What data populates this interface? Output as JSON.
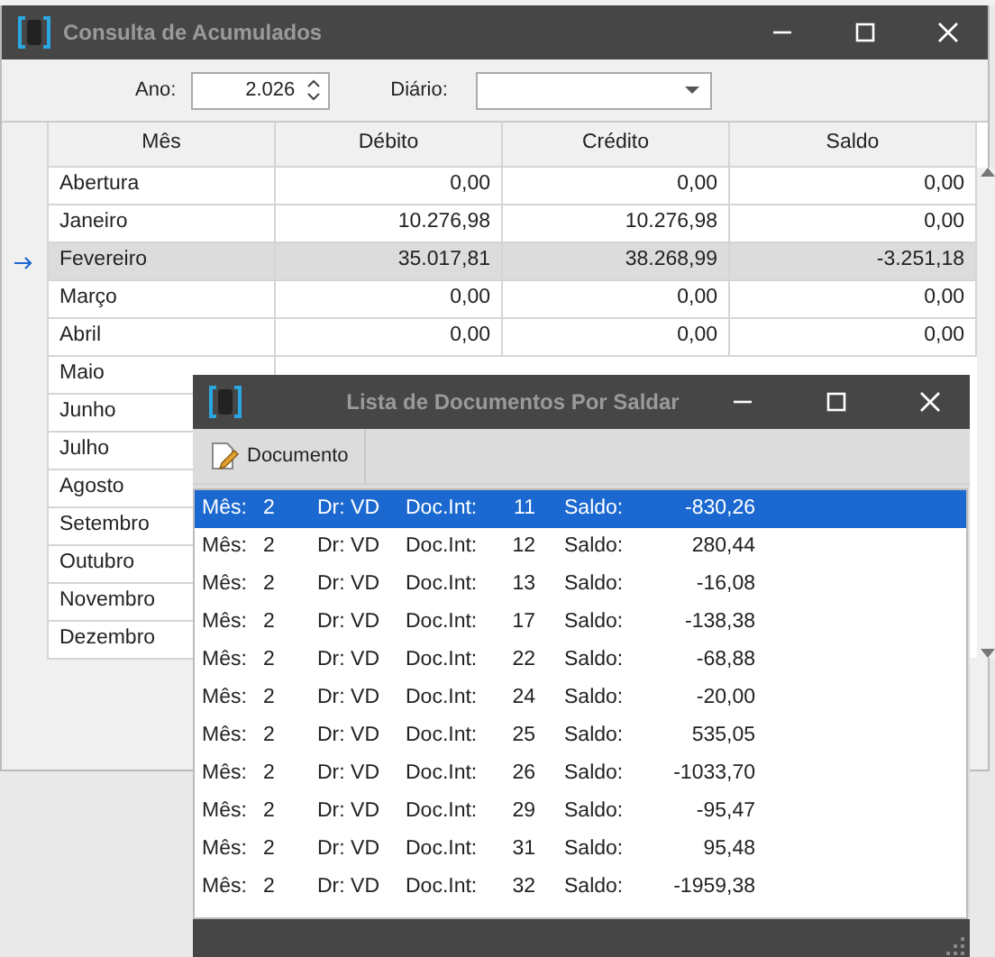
{
  "main_window": {
    "title": "Consulta de Acumulados",
    "filters": {
      "year_label": "Ano:",
      "year_value": "2.026",
      "journal_label": "Diário:"
    },
    "table": {
      "columns": [
        "Mês",
        "Débito",
        "Crédito",
        "Saldo"
      ],
      "rows": [
        {
          "cells": [
            "Abertura",
            "0,00",
            "0,00",
            "0,00"
          ],
          "selected": false
        },
        {
          "cells": [
            "Janeiro",
            "10.276,98",
            "10.276,98",
            "0,00"
          ],
          "selected": false
        },
        {
          "cells": [
            "Fevereiro",
            "35.017,81",
            "38.268,99",
            "-3.251,18"
          ],
          "selected": true
        },
        {
          "cells": [
            "Março",
            "0,00",
            "0,00",
            "0,00"
          ],
          "selected": false
        },
        {
          "cells": [
            "Abril",
            "0,00",
            "0,00",
            "0,00"
          ],
          "selected": false
        },
        {
          "cells": [
            "Maio"
          ],
          "selected": false
        },
        {
          "cells": [
            "Junho"
          ],
          "selected": false
        },
        {
          "cells": [
            "Julho"
          ],
          "selected": false
        },
        {
          "cells": [
            "Agosto"
          ],
          "selected": false
        },
        {
          "cells": [
            "Setembro"
          ],
          "selected": false
        },
        {
          "cells": [
            "Outubro"
          ],
          "selected": false
        },
        {
          "cells": [
            "Novembro"
          ],
          "selected": false
        },
        {
          "cells": [
            "Dezembro"
          ],
          "selected": false
        }
      ]
    }
  },
  "dialog": {
    "title": "Lista de Documentos Por Saldar",
    "toolbar": [
      "Documento"
    ],
    "rows": [
      {
        "month_label": "Mês:",
        "month": "2",
        "journal": "Dr: VD",
        "doc_label": "Doc.Int:",
        "doc": "11",
        "balance_label": "Saldo:",
        "balance": "-830,26",
        "selected": true
      },
      {
        "month_label": "Mês:",
        "month": "2",
        "journal": "Dr: VD",
        "doc_label": "Doc.Int:",
        "doc": "12",
        "balance_label": "Saldo:",
        "balance": "280,44",
        "selected": false
      },
      {
        "month_label": "Mês:",
        "month": "2",
        "journal": "Dr: VD",
        "doc_label": "Doc.Int:",
        "doc": "13",
        "balance_label": "Saldo:",
        "balance": "-16,08",
        "selected": false
      },
      {
        "month_label": "Mês:",
        "month": "2",
        "journal": "Dr: VD",
        "doc_label": "Doc.Int:",
        "doc": "17",
        "balance_label": "Saldo:",
        "balance": "-138,38",
        "selected": false
      },
      {
        "month_label": "Mês:",
        "month": "2",
        "journal": "Dr: VD",
        "doc_label": "Doc.Int:",
        "doc": "22",
        "balance_label": "Saldo:",
        "balance": "-68,88",
        "selected": false
      },
      {
        "month_label": "Mês:",
        "month": "2",
        "journal": "Dr: VD",
        "doc_label": "Doc.Int:",
        "doc": "24",
        "balance_label": "Saldo:",
        "balance": "-20,00",
        "selected": false
      },
      {
        "month_label": "Mês:",
        "month": "2",
        "journal": "Dr: VD",
        "doc_label": "Doc.Int:",
        "doc": "25",
        "balance_label": "Saldo:",
        "balance": "535,05",
        "selected": false
      },
      {
        "month_label": "Mês:",
        "month": "2",
        "journal": "Dr: VD",
        "doc_label": "Doc.Int:",
        "doc": "26",
        "balance_label": "Saldo:",
        "balance": "-1033,70",
        "selected": false
      },
      {
        "month_label": "Mês:",
        "month": "2",
        "journal": "Dr: VD",
        "doc_label": "Doc.Int:",
        "doc": "29",
        "balance_label": "Saldo:",
        "balance": "-95,47",
        "selected": false
      },
      {
        "month_label": "Mês:",
        "month": "2",
        "journal": "Dr: VD",
        "doc_label": "Doc.Int:",
        "doc": "31",
        "balance_label": "Saldo:",
        "balance": "95,48",
        "selected": false
      },
      {
        "month_label": "Mês:",
        "month": "2",
        "journal": "Dr: VD",
        "doc_label": "Doc.Int:",
        "doc": "32",
        "balance_label": "Saldo:",
        "balance": "-1959,38",
        "selected": false
      }
    ]
  }
}
